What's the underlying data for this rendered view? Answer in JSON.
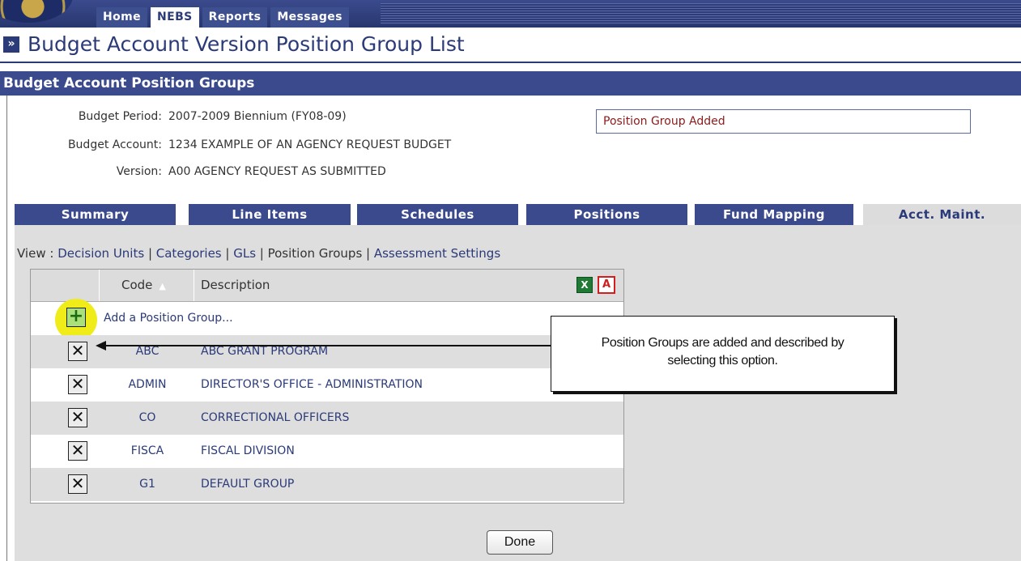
{
  "nav": {
    "tabs": [
      {
        "label": "Home"
      },
      {
        "label": "NEBS"
      },
      {
        "label": "Reports"
      },
      {
        "label": "Messages"
      }
    ],
    "active": "NEBS"
  },
  "page": {
    "title": "Budget Account Version Position Group List",
    "title_glyph": "»"
  },
  "section": {
    "title": "Budget Account Position Groups"
  },
  "info": {
    "period_label": "Budget Period:",
    "period_value": "2007-2009 Biennium (FY08-09)",
    "account_label": "Budget Account:",
    "account_value": "1234 EXAMPLE OF AN AGENCY REQUEST BUDGET",
    "version_label": "Version:",
    "version_value": "A00 AGENCY REQUEST AS SUBMITTED"
  },
  "message": "Position Group Added",
  "tabs": [
    {
      "label": "Summary"
    },
    {
      "label": "Line Items"
    },
    {
      "label": "Schedules"
    },
    {
      "label": "Positions"
    },
    {
      "label": "Fund Mapping"
    },
    {
      "label": "Acct. Maint."
    }
  ],
  "active_tab": "Acct. Maint.",
  "view": {
    "prefix": "View : ",
    "sep": " | ",
    "links": [
      "Decision Units",
      "Categories",
      "GLs",
      "Position Groups",
      "Assessment Settings"
    ],
    "current": "Position Groups"
  },
  "grid": {
    "columns": {
      "code": "Code",
      "description": "Description"
    },
    "add_label": "Add a Position Group...",
    "rows": [
      {
        "code": "ABC",
        "description": "ABC GRANT PROGRAM"
      },
      {
        "code": "ADMIN",
        "description": "DIRECTOR'S OFFICE - ADMINISTRATION"
      },
      {
        "code": "CO",
        "description": "CORRECTIONAL OFFICERS"
      },
      {
        "code": "FISCA",
        "description": "FISCAL DIVISION"
      },
      {
        "code": "G1",
        "description": "DEFAULT GROUP"
      }
    ]
  },
  "callout": {
    "line1": "Position Groups are added and described by",
    "line2": "selecting this option."
  },
  "done_label": "Done",
  "colors": {
    "nav_blue": "#3b4a8c",
    "highlight": "#f0ec1a",
    "message_text": "#8b1a1a"
  },
  "icons": [
    "state-seal",
    "double-chevron-icon",
    "excel-export-icon",
    "pdf-export-icon",
    "add-icon",
    "delete-icon",
    "sort-ascending-icon"
  ]
}
